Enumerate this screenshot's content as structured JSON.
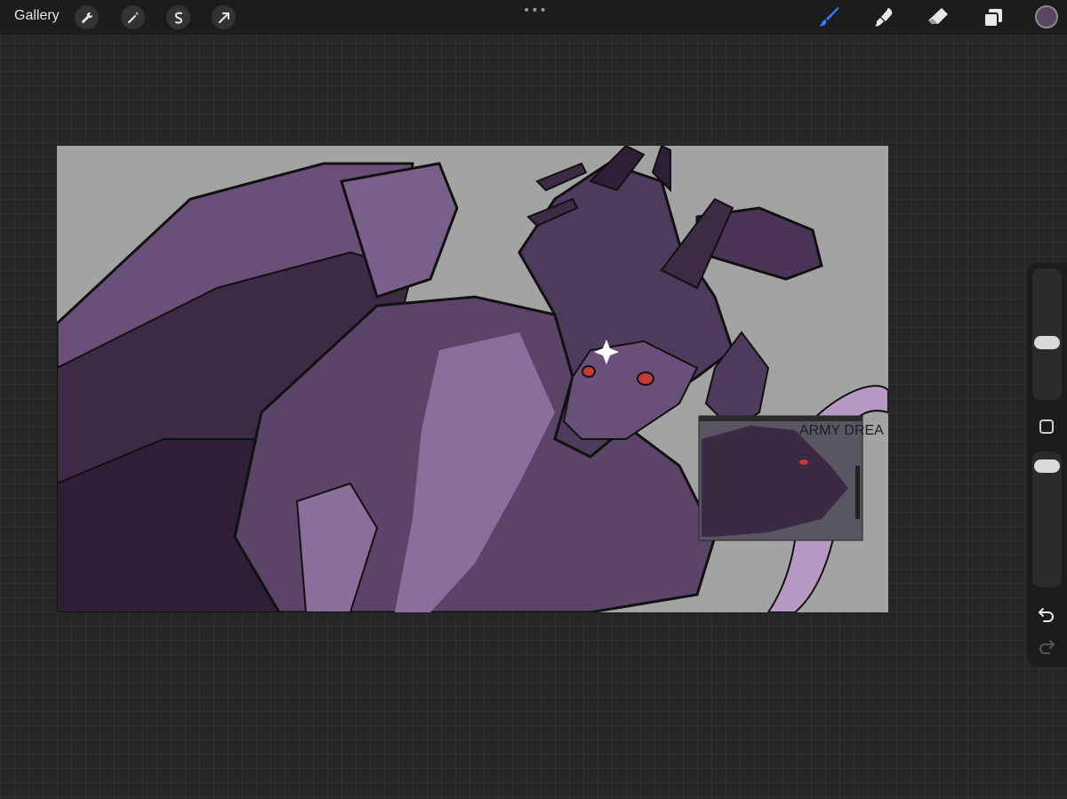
{
  "topbar": {
    "gallery_label": "Gallery",
    "more_dots": "•••",
    "left_tools": [
      "wrench-icon",
      "magic-wand-icon",
      "selection-icon",
      "transform-arrow-icon"
    ],
    "right_tools": [
      "brush-icon",
      "smudge-icon",
      "eraser-icon",
      "layers-icon"
    ],
    "active_tool": "brush-icon",
    "active_tool_color": "#2f7cf6",
    "current_color": "#5a4563"
  },
  "canvas": {
    "background": "#a3a3a3",
    "subject": "purple-dragon-artwork",
    "inset_text": "ARMY DREA"
  },
  "sidebar": {
    "size_slider": "brush-size-slider",
    "opacity_slider": "brush-opacity-slider",
    "modify_button": "modify-button",
    "undo": "undo-icon",
    "redo": "redo-icon"
  },
  "colors": {
    "dragon_dark": "#3d2a45",
    "dragon_mid": "#5e4670",
    "dragon_light": "#8a6f9a",
    "eye_red": "#c83a3a"
  }
}
